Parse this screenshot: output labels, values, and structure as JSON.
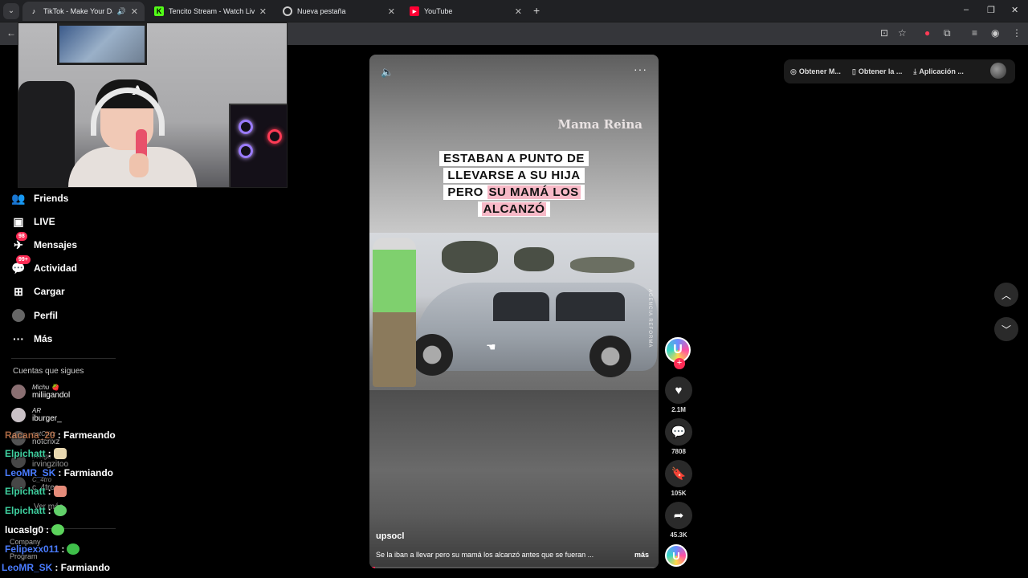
{
  "browser": {
    "tabs": [
      {
        "title": "TikTok - Make Your Day",
        "icon": "tiktok-icon",
        "active": true
      },
      {
        "title": "Tencito Stream - Watch Live on",
        "icon": "kick-icon"
      },
      {
        "title": "Nueva pestaña",
        "icon": "chrome-icon"
      },
      {
        "title": "YouTube",
        "icon": "youtube-icon"
      }
    ],
    "new_tab": "+",
    "window_controls": {
      "minimize": "–",
      "maximize": "❐",
      "close": "✕"
    }
  },
  "header": {
    "get_app_1": "Obtener M...",
    "get_app_2": "Obtener la ...",
    "get_app_3": "Aplicación ..."
  },
  "sidebar": {
    "items": [
      {
        "label": "Friends",
        "icon": "friends-icon"
      },
      {
        "label": "LIVE",
        "icon": "live-icon"
      },
      {
        "label": "Mensajes",
        "icon": "messages-icon",
        "badge": "98"
      },
      {
        "label": "Actividad",
        "icon": "activity-icon",
        "badge": "99+"
      },
      {
        "label": "Cargar",
        "icon": "upload-icon"
      },
      {
        "label": "Perfil",
        "icon": "profile-icon"
      },
      {
        "label": "Más",
        "icon": "more-icon"
      }
    ],
    "following_title": "Cuentas que sigues",
    "following": [
      {
        "display": "Michu 🍓",
        "handle": "miliigandol"
      },
      {
        "display": "AR",
        "handle": "iburger_"
      },
      {
        "display": "notCrixz",
        "handle": "notcrixz"
      },
      {
        "display": "irvinga",
        "handle": "irvingzitoo"
      },
      {
        "display": "C_4tro",
        "handle": "c_4treo"
      },
      {
        "display": "Ver más",
        "handle": ""
      }
    ],
    "footer": {
      "company": "Company",
      "program": "Program"
    }
  },
  "chat": [
    {
      "user": "Racana_20",
      "msg": ": Farmeando",
      "color": "#e08a5a"
    },
    {
      "user": "Elpichatt",
      "msg": ":",
      "color": "#3fd1a0"
    },
    {
      "user": "LeoMR_SK",
      "msg": ": Farmiando",
      "color": "#4a7cff"
    },
    {
      "user": "Elpichatt",
      "msg": ":",
      "color": "#3fd1a0"
    },
    {
      "user": "Elpichatt",
      "msg": ":",
      "color": "#3fd1a0"
    },
    {
      "user": "lucaslg0",
      "msg": ":",
      "color": "#ffffff"
    },
    {
      "user": "Felipexx011",
      "msg": ":",
      "color": "#4a7cff"
    },
    {
      "user": "LeoMR_SK",
      "msg": ": Farmiando",
      "color": "#4a7cff"
    }
  ],
  "video": {
    "brand": "Mama Reina",
    "caption_lines": [
      "ESTABAN A PUNTO DE",
      "LLEVARSE A SU HIJA"
    ],
    "caption_line3_a": "PERO",
    "caption_line3_b": "SU MAMÁ LOS",
    "caption_line4": "ALCANZÓ",
    "watermark": "AGENCIA REFORMA",
    "username": "upsocl",
    "description": "Se la iban a llevar pero su mamá los alcanzó antes que se fueran ...",
    "more_label": "más",
    "progress": 0.02
  },
  "actions": {
    "likes": "2.1M",
    "comments": "7808",
    "saves": "105K",
    "shares": "45.3K"
  },
  "colors": {
    "accent": "#fe2c55",
    "bg": "#000000"
  }
}
